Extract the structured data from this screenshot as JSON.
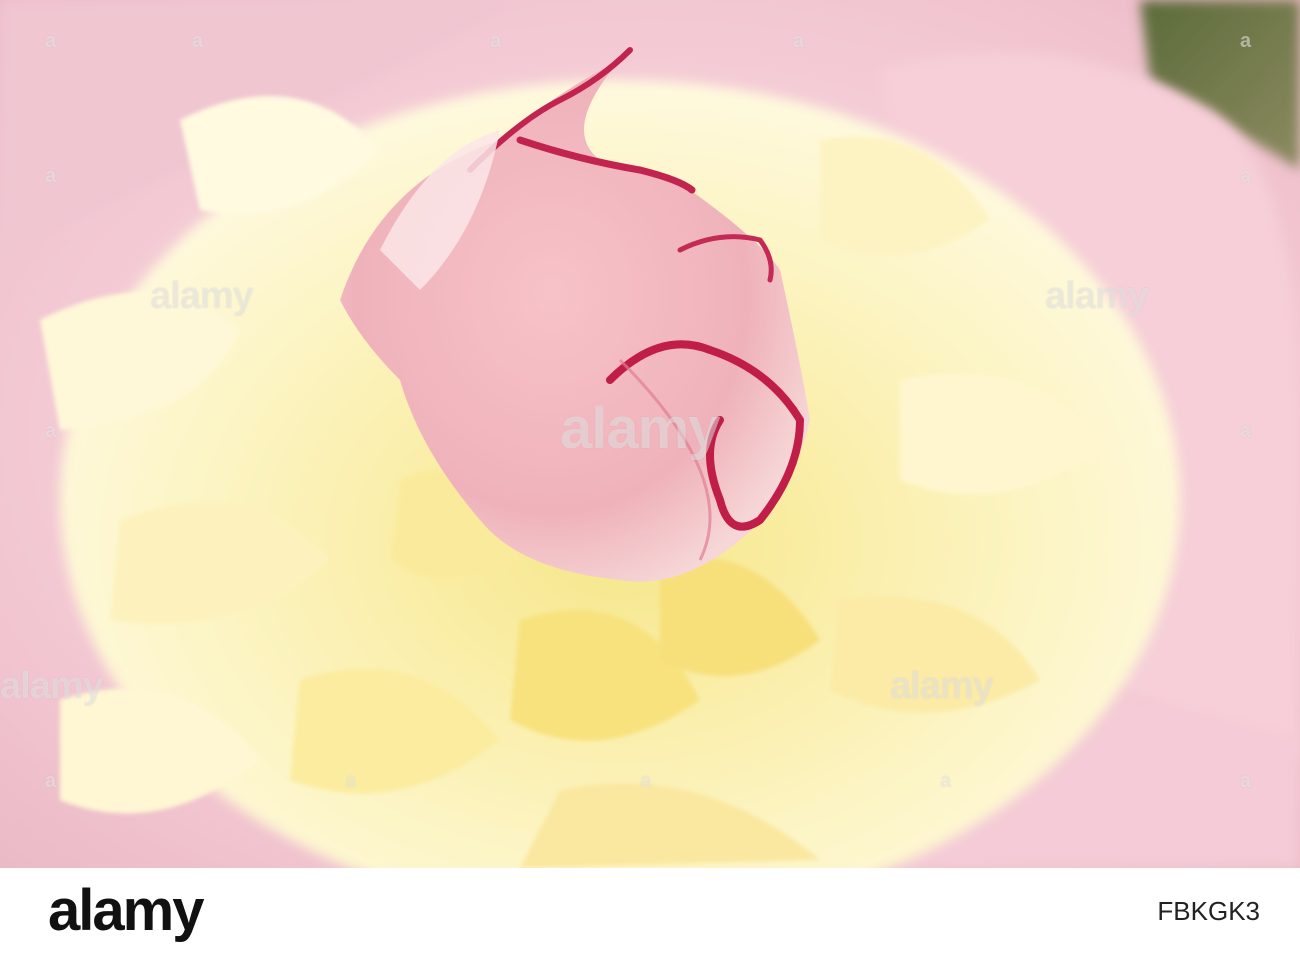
{
  "watermark": {
    "brand": "alamy",
    "symbol": "a"
  },
  "footer": {
    "logo": "alamy",
    "image_id": "FBKGK3"
  }
}
